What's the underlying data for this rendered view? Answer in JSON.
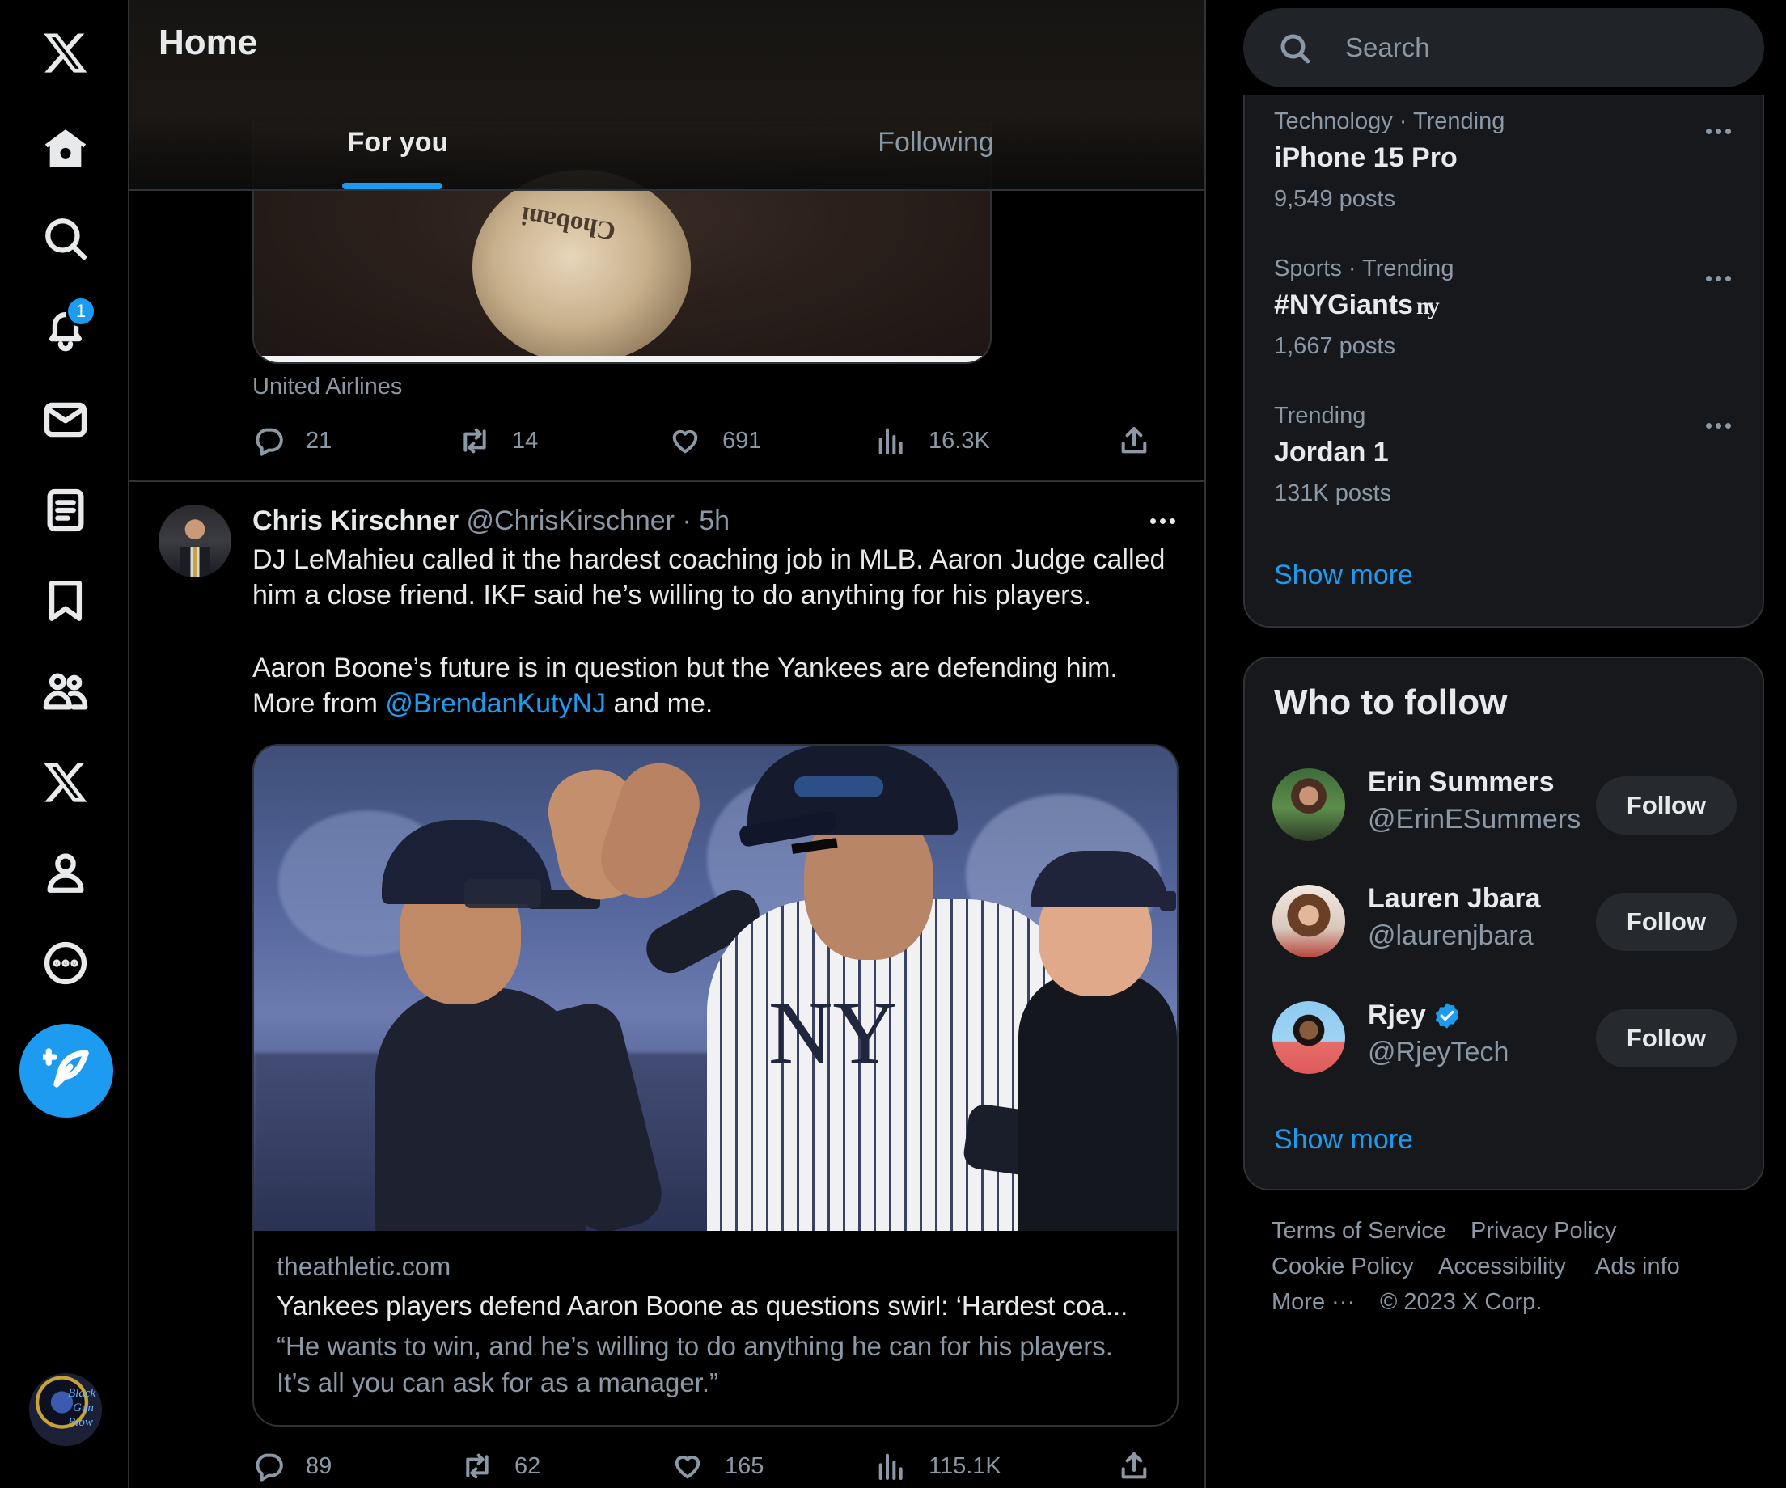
{
  "nav": {
    "items": [
      {
        "icon": "x-logo-icon"
      },
      {
        "icon": "home-icon"
      },
      {
        "icon": "explore-icon"
      },
      {
        "icon": "notifications-icon",
        "badge": "1"
      },
      {
        "icon": "messages-icon"
      },
      {
        "icon": "lists-icon"
      },
      {
        "icon": "bookmarks-icon"
      },
      {
        "icon": "communities-icon"
      },
      {
        "icon": "premium-icon"
      },
      {
        "icon": "profile-icon"
      },
      {
        "icon": "more-icon"
      }
    ],
    "compose_icon": "feather-plus-icon",
    "account_avatar_text": [
      "Black",
      "Gun",
      "Blow"
    ]
  },
  "header": {
    "title": "Home",
    "tabs": [
      {
        "label": "For you",
        "selected": true
      },
      {
        "label": "Following",
        "selected": false
      }
    ]
  },
  "tweet1": {
    "media_text": "Chobani",
    "source": "United Airlines",
    "stats": {
      "replies": "21",
      "reposts": "14",
      "likes": "691",
      "views": "16.3K"
    }
  },
  "tweet2": {
    "author_name": "Chris Kirschner",
    "author_handle": "@ChrisKirschner",
    "separator": "·",
    "time": "5h",
    "text_lines": [
      "DJ LeMahieu called it the hardest coaching job in MLB. Aaron Judge called",
      "him a close friend. IKF said he’s willing to do anything for his players.",
      "Aaron Boone’s future is in question but the Yankees are defending him."
    ],
    "text_more_prefix": "More from ",
    "text_mention": "@BrendanKutyNJ",
    "text_more_suffix": " and me.",
    "card": {
      "domain": "theathletic.com",
      "title": "Yankees players defend Aaron Boone as questions swirl: ‘Hardest coa...",
      "description_lines": [
        "“He wants to win, and he’s willing to do anything he can for his players.",
        "It’s all you can ask for as a manager.”"
      ]
    },
    "stats": {
      "replies": "89",
      "reposts": "62",
      "likes": "165",
      "views": "115.1K"
    }
  },
  "search": {
    "placeholder": "Search"
  },
  "trends": {
    "items": [
      {
        "meta": "Technology · Trending",
        "name": "iPhone 15 Pro",
        "count": "9,549 posts"
      },
      {
        "meta": "Sports · Trending",
        "name": "#NYGiants",
        "count": "1,667 posts",
        "hashflag": "ny"
      },
      {
        "meta": "Trending",
        "name": "Jordan 1",
        "count": "131K posts"
      }
    ],
    "show_more": "Show more"
  },
  "who_to_follow": {
    "title": "Who to follow",
    "users": [
      {
        "name": "Erin Summers",
        "handle": "@ErinESummers",
        "button": "Follow",
        "verified": false
      },
      {
        "name": "Lauren Jbara",
        "handle": "@laurenjbara",
        "button": "Follow",
        "verified": false
      },
      {
        "name": "Rjey",
        "handle": "@RjeyTech",
        "button": "Follow",
        "verified": true
      }
    ],
    "show_more": "Show more"
  },
  "footer": {
    "links": [
      "Terms of Service",
      "Privacy Policy",
      "Cookie Policy",
      "Accessibility",
      "Ads info",
      "More ···"
    ],
    "copyright": "© 2023 X Corp."
  },
  "colors": {
    "accent": "#1d9bf0",
    "background": "#000000",
    "panel": "#16181c",
    "border": "#2f3336",
    "muted_text": "#8b98a5"
  }
}
